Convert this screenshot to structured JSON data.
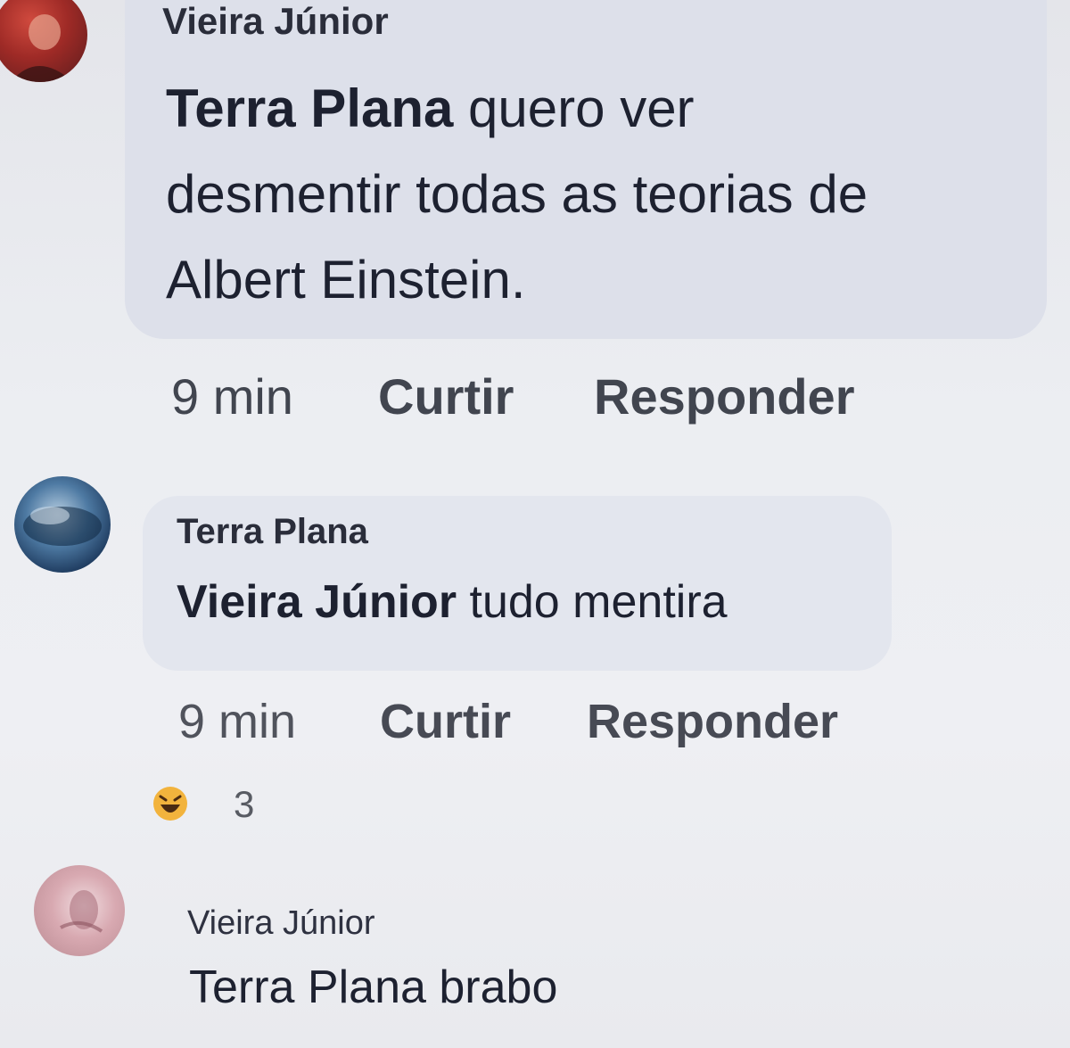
{
  "comments": [
    {
      "author": "Vieira Júnior",
      "mention": "Terra Plana",
      "text_lines": [
        " quero ver",
        "desmentir todas as teorias de",
        "Albert Einstein."
      ],
      "time": "9 min",
      "like_label": "Curtir",
      "reply_label": "Responder"
    },
    {
      "author": "Terra Plana",
      "mention": "Vieira Júnior",
      "text": " tudo mentira",
      "time": "9 min",
      "like_label": "Curtir",
      "reply_label": "Responder",
      "reaction": {
        "icon": "laughing-emoji-icon",
        "count": "3"
      }
    },
    {
      "author": "Vieira Júnior",
      "mention": "Terra Plana",
      "text": " brabo"
    }
  ],
  "colors": {
    "background": "#eceef2",
    "bubble": "#dfe2eb",
    "text": "#1d2130",
    "reaction": "#f2b33d"
  }
}
